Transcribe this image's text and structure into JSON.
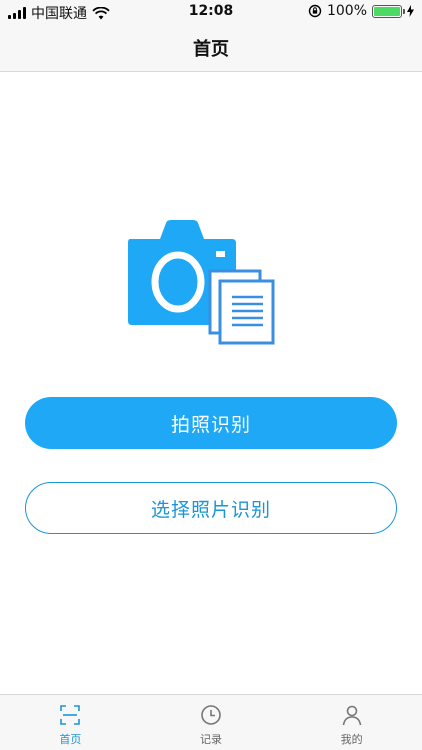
{
  "status_bar": {
    "carrier": "中国联通",
    "time": "12:08",
    "battery_percent": "100%",
    "battery_level": 1.0,
    "icons": [
      "signal-icon",
      "wifi-icon",
      "rotation-lock-icon",
      "battery-icon",
      "charging-icon"
    ]
  },
  "nav": {
    "title": "首页"
  },
  "main": {
    "illustration_icon": "camera-document-icon",
    "primary_button": "拍照识别",
    "secondary_button": "选择照片识别"
  },
  "tabs": [
    {
      "label": "首页",
      "icon": "scan-icon",
      "active": true
    },
    {
      "label": "记录",
      "icon": "clock-icon",
      "active": false
    },
    {
      "label": "我的",
      "icon": "person-icon",
      "active": false
    }
  ],
  "colors": {
    "accent": "#1ea8f5",
    "accent_dark": "#1a96d8",
    "camera_blue": "#1ea8f5",
    "document_blue": "#3a8fe0"
  }
}
